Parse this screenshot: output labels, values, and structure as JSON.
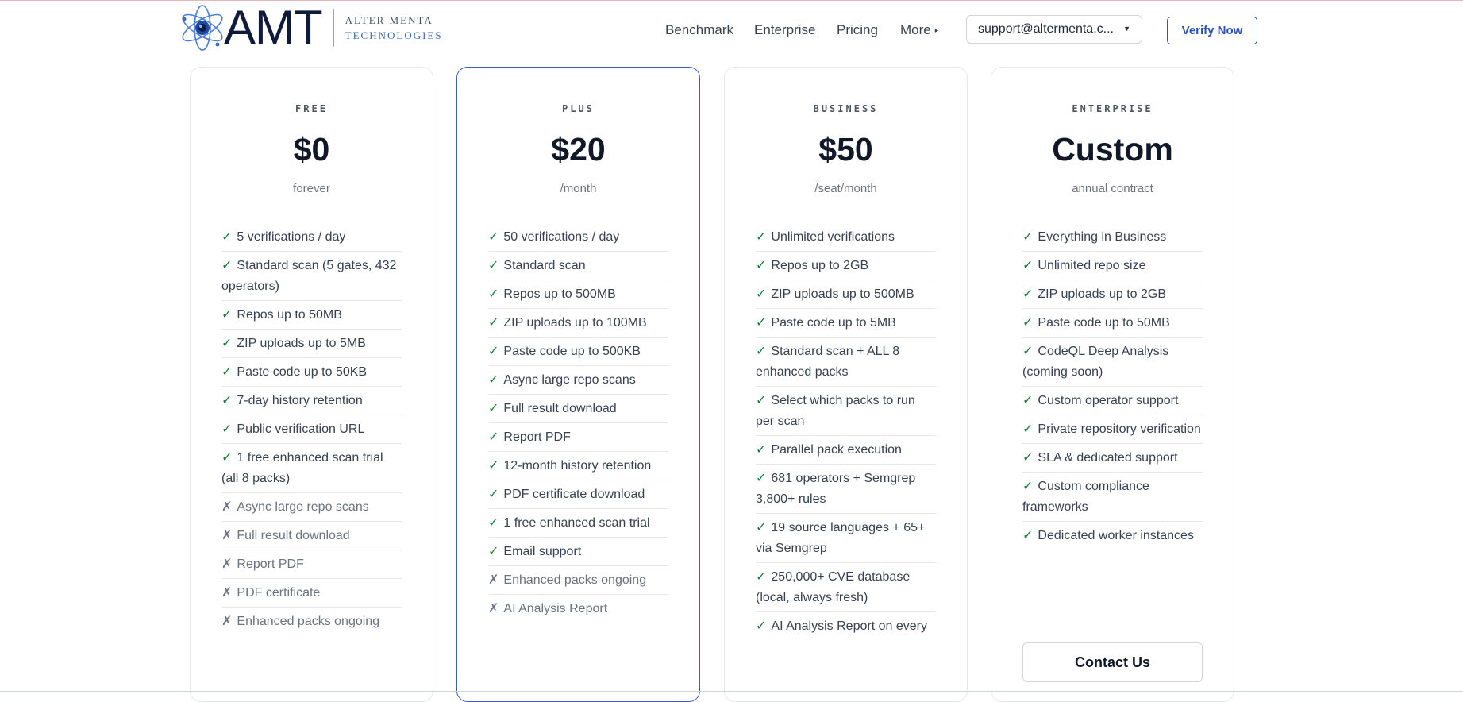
{
  "brand": {
    "mark": "AMT",
    "name_line1": "ALTER MENTA",
    "name_line2": "TECHNOLOGIES"
  },
  "nav": {
    "items": [
      {
        "label": "Benchmark"
      },
      {
        "label": "Enterprise"
      },
      {
        "label": "Pricing"
      },
      {
        "label": "More"
      }
    ],
    "account": "support@altermenta.c...",
    "cta": "Verify Now"
  },
  "plans": [
    {
      "tier": "FREE",
      "price": "$0",
      "period": "forever",
      "features": [
        {
          "mark": "✓",
          "text": "5 verifications / day",
          "included": true
        },
        {
          "mark": "✓",
          "text": "Standard scan (5 gates, 432 operators)",
          "included": true
        },
        {
          "mark": "✓",
          "text": "Repos up to 50MB",
          "included": true
        },
        {
          "mark": "✓",
          "text": "ZIP uploads up to 5MB",
          "included": true
        },
        {
          "mark": "✓",
          "text": "Paste code up to 50KB",
          "included": true
        },
        {
          "mark": "✓",
          "text": "7-day history retention",
          "included": true
        },
        {
          "mark": "✓",
          "text": "Public verification URL",
          "included": true
        },
        {
          "mark": "✓",
          "text": "1 free enhanced scan trial (all 8 packs)",
          "included": true
        },
        {
          "mark": "✗",
          "text": "Async large repo scans",
          "included": false
        },
        {
          "mark": "✗",
          "text": "Full result download",
          "included": false
        },
        {
          "mark": "✗",
          "text": "Report PDF",
          "included": false
        },
        {
          "mark": "✗",
          "text": "PDF certificate",
          "included": false
        },
        {
          "mark": "✗",
          "text": "Enhanced packs ongoing",
          "included": false
        }
      ]
    },
    {
      "tier": "PLUS",
      "price": "$20",
      "period": "/month",
      "features": [
        {
          "mark": "✓",
          "text": "50 verifications / day",
          "included": true
        },
        {
          "mark": "✓",
          "text": "Standard scan",
          "included": true
        },
        {
          "mark": "✓",
          "text": "Repos up to 500MB",
          "included": true
        },
        {
          "mark": "✓",
          "text": "ZIP uploads up to 100MB",
          "included": true
        },
        {
          "mark": "✓",
          "text": "Paste code up to 500KB",
          "included": true
        },
        {
          "mark": "✓",
          "text": "Async large repo scans",
          "included": true
        },
        {
          "mark": "✓",
          "text": "Full result download",
          "included": true
        },
        {
          "mark": "✓",
          "text": "Report PDF",
          "included": true
        },
        {
          "mark": "✓",
          "text": "12-month history retention",
          "included": true
        },
        {
          "mark": "✓",
          "text": "PDF certificate download",
          "included": true
        },
        {
          "mark": "✓",
          "text": "1 free enhanced scan trial",
          "included": true
        },
        {
          "mark": "✓",
          "text": "Email support",
          "included": true
        },
        {
          "mark": "✗",
          "text": "Enhanced packs ongoing",
          "included": false
        },
        {
          "mark": "✗",
          "text": "AI Analysis Report",
          "included": false
        }
      ]
    },
    {
      "tier": "BUSINESS",
      "price": "$50",
      "period": "/seat/month",
      "features": [
        {
          "mark": "✓",
          "text": "Unlimited verifications",
          "included": true
        },
        {
          "mark": "✓",
          "text": "Repos up to 2GB",
          "included": true
        },
        {
          "mark": "✓",
          "text": "ZIP uploads up to 500MB",
          "included": true
        },
        {
          "mark": "✓",
          "text": "Paste code up to 5MB",
          "included": true
        },
        {
          "mark": "✓",
          "text": "Standard scan + ALL 8 enhanced packs",
          "included": true
        },
        {
          "mark": "✓",
          "text": "Select which packs to run per scan",
          "included": true
        },
        {
          "mark": "✓",
          "text": "Parallel pack execution",
          "included": true
        },
        {
          "mark": "✓",
          "text": "681 operators + Semgrep 3,800+ rules",
          "included": true
        },
        {
          "mark": "✓",
          "text": "19 source languages + 65+ via Semgrep",
          "included": true
        },
        {
          "mark": "✓",
          "text": "250,000+ CVE database (local, always fresh)",
          "included": true
        },
        {
          "mark": "✓",
          "text": "AI Analysis Report on every",
          "included": true
        }
      ]
    },
    {
      "tier": "ENTERPRISE",
      "price": "Custom",
      "period": "annual contract",
      "features": [
        {
          "mark": "✓",
          "text": "Everything in Business",
          "included": true
        },
        {
          "mark": "✓",
          "text": "Unlimited repo size",
          "included": true
        },
        {
          "mark": "✓",
          "text": "ZIP uploads up to 2GB",
          "included": true
        },
        {
          "mark": "✓",
          "text": "Paste code up to 50MB",
          "included": true
        },
        {
          "mark": "✓",
          "text": "CodeQL Deep Analysis (coming soon)",
          "included": true
        },
        {
          "mark": "✓",
          "text": "Custom operator support",
          "included": true
        },
        {
          "mark": "✓",
          "text": "Private repository verification",
          "included": true
        },
        {
          "mark": "✓",
          "text": "SLA & dedicated support",
          "included": true
        },
        {
          "mark": "✓",
          "text": "Custom compliance frameworks",
          "included": true
        },
        {
          "mark": "✓",
          "text": "Dedicated worker instances",
          "included": true
        }
      ],
      "cta": "Contact Us"
    }
  ],
  "colors": {
    "accent": "#2b54b8",
    "check": "#15803d",
    "featured_border": "#3b5fc0"
  }
}
